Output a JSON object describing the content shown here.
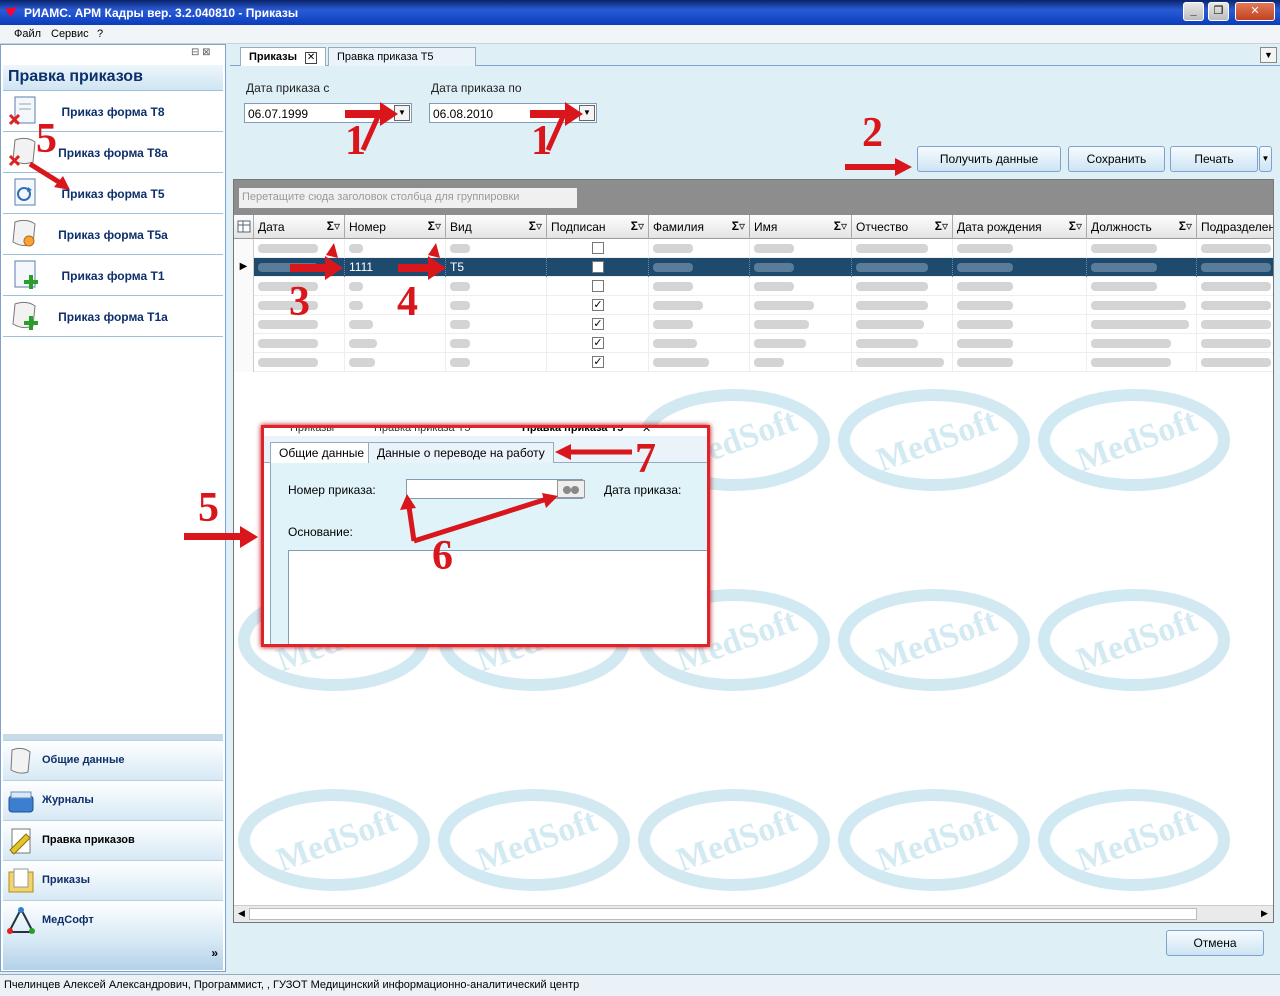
{
  "window": {
    "title": "РИАМС. АРМ Кадры вер. 3.2.040810 - Приказы"
  },
  "menu": [
    "Файл",
    "Сервис",
    "?"
  ],
  "left_panel": {
    "header": "Правка приказов",
    "forms": [
      {
        "label": "Приказ форма Т8",
        "icon": "doc-delete-icon"
      },
      {
        "label": "Приказ форма Т8а",
        "icon": "scroll-delete-icon"
      },
      {
        "label": "Приказ форма Т5",
        "icon": "doc-refresh-icon"
      },
      {
        "label": "Приказ форма Т5а",
        "icon": "scroll-refresh-icon"
      },
      {
        "label": "Приказ форма Т1",
        "icon": "doc-add-icon"
      },
      {
        "label": "Приказ форма Т1а",
        "icon": "scroll-add-icon"
      }
    ],
    "nav": [
      {
        "label": "Общие данные",
        "icon": "scroll-icon"
      },
      {
        "label": "Журналы",
        "icon": "box-icon"
      },
      {
        "label": "Правка приказов",
        "icon": "pencil-doc-icon"
      },
      {
        "label": "Приказы",
        "icon": "folder-icon"
      },
      {
        "label": "МедСофт",
        "icon": "medsoft-logo-icon"
      }
    ],
    "expand_glyph": "»"
  },
  "tabs": [
    {
      "label": "Приказы",
      "active": true
    },
    {
      "label": "Правка приказа Т5",
      "active": false
    }
  ],
  "filters": {
    "date_from_label": "Дата приказа с",
    "date_from_value": "06.07.1999",
    "date_to_label": "Дата приказа по",
    "date_to_value": "06.08.2010"
  },
  "buttons": {
    "get_data": "Получить данные",
    "save": "Сохранить",
    "print": "Печать",
    "cancel": "Отмена"
  },
  "grid": {
    "group_placeholder": "Перетащите сюда заголовок столбца для группировки",
    "columns": [
      "Дата",
      "Номер",
      "Вид",
      "Подписан",
      "Фамилия",
      "Имя",
      "Отчество",
      "Дата рождения",
      "Должность",
      "Подразделени"
    ],
    "selected_row": {
      "number": "1111",
      "kind": "Т5"
    },
    "signed": [
      false,
      false,
      false,
      true,
      true,
      true,
      true
    ]
  },
  "edit_dialog": {
    "back_tabs": [
      "Приказы",
      "Правка приказа Т5",
      "Правка приказа Т5"
    ],
    "tabs": [
      "Общие данные",
      "Данные о переводе на работу"
    ],
    "order_number_label": "Номер приказа:",
    "order_date_label": "Дата приказа:",
    "basis_label": "Основание:"
  },
  "watermark_text": "MedSoft",
  "annotations": [
    "1",
    "1",
    "2",
    "3",
    "4",
    "5",
    "5",
    "6",
    "7"
  ],
  "status": "Пчелинцев Алексей Александрович, Программист, , ГУЗОТ Медицинский информационно-аналитический центр",
  "colors": {
    "accent": "#d9161c",
    "selected_row": "#1e4a6e",
    "panel": "#dfeff6"
  }
}
